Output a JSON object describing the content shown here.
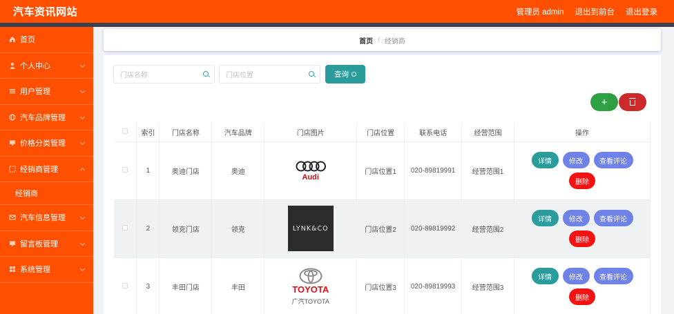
{
  "header": {
    "site_title": "汽车资讯网站",
    "user_label": "管理员 admin",
    "to_front": "退出到前台",
    "logout": "退出登录"
  },
  "sidebar": {
    "items": [
      {
        "label": "首页",
        "icon": "home-icon"
      },
      {
        "label": "个人中心",
        "icon": "user-icon"
      },
      {
        "label": "用户管理",
        "icon": "list-icon"
      },
      {
        "label": "汽车品牌管理",
        "icon": "globe-icon"
      },
      {
        "label": "价格分类管理",
        "icon": "monitor-icon"
      },
      {
        "label": "经销商管理",
        "icon": "frame-icon"
      },
      {
        "label": "经销商",
        "icon": ""
      },
      {
        "label": "汽车信息管理",
        "icon": "mail-icon"
      },
      {
        "label": "留言板管理",
        "icon": "monitor-icon"
      },
      {
        "label": "系统管理",
        "icon": "grid-icon"
      }
    ]
  },
  "breadcrumb": {
    "home": "首页",
    "separator": "/",
    "current": "经销商"
  },
  "search": {
    "store_name_placeholder": "门店名称",
    "store_location_placeholder": "门店位置",
    "button_label": "查询"
  },
  "toolbar": {
    "add_label": "+"
  },
  "table": {
    "headers": [
      "索引",
      "门店名称",
      "汽车品牌",
      "门店图片",
      "门店位置",
      "联系电话",
      "经营范围",
      "操作"
    ],
    "rows": [
      {
        "index": "1",
        "name": "奥迪门店",
        "brand": "奥迪",
        "logo_text": "Audi",
        "location": "门店位置1",
        "phone": "020-89819991",
        "scope": "经营范围1"
      },
      {
        "index": "2",
        "name": "领克门店",
        "brand": "领克",
        "logo_text": "LYNK&CO",
        "location": "门店位置2",
        "phone": "020-89819992",
        "scope": "经营范围2"
      },
      {
        "index": "3",
        "name": "丰田门店",
        "brand": "丰田",
        "logo_text": "TOYOTA",
        "logo_sub": "广汽TOYOTA",
        "location": "门店位置3",
        "phone": "020-89819993",
        "scope": "经营范围3"
      }
    ],
    "actions": {
      "detail": "详情",
      "edit": "修改",
      "review": "查看评论",
      "delete": "删除"
    }
  },
  "colors": {
    "brand": "#ff4f00",
    "teal": "#2a9c9c",
    "indigo": "#6f82e8",
    "danger": "#f31313",
    "add": "#2ea043"
  }
}
